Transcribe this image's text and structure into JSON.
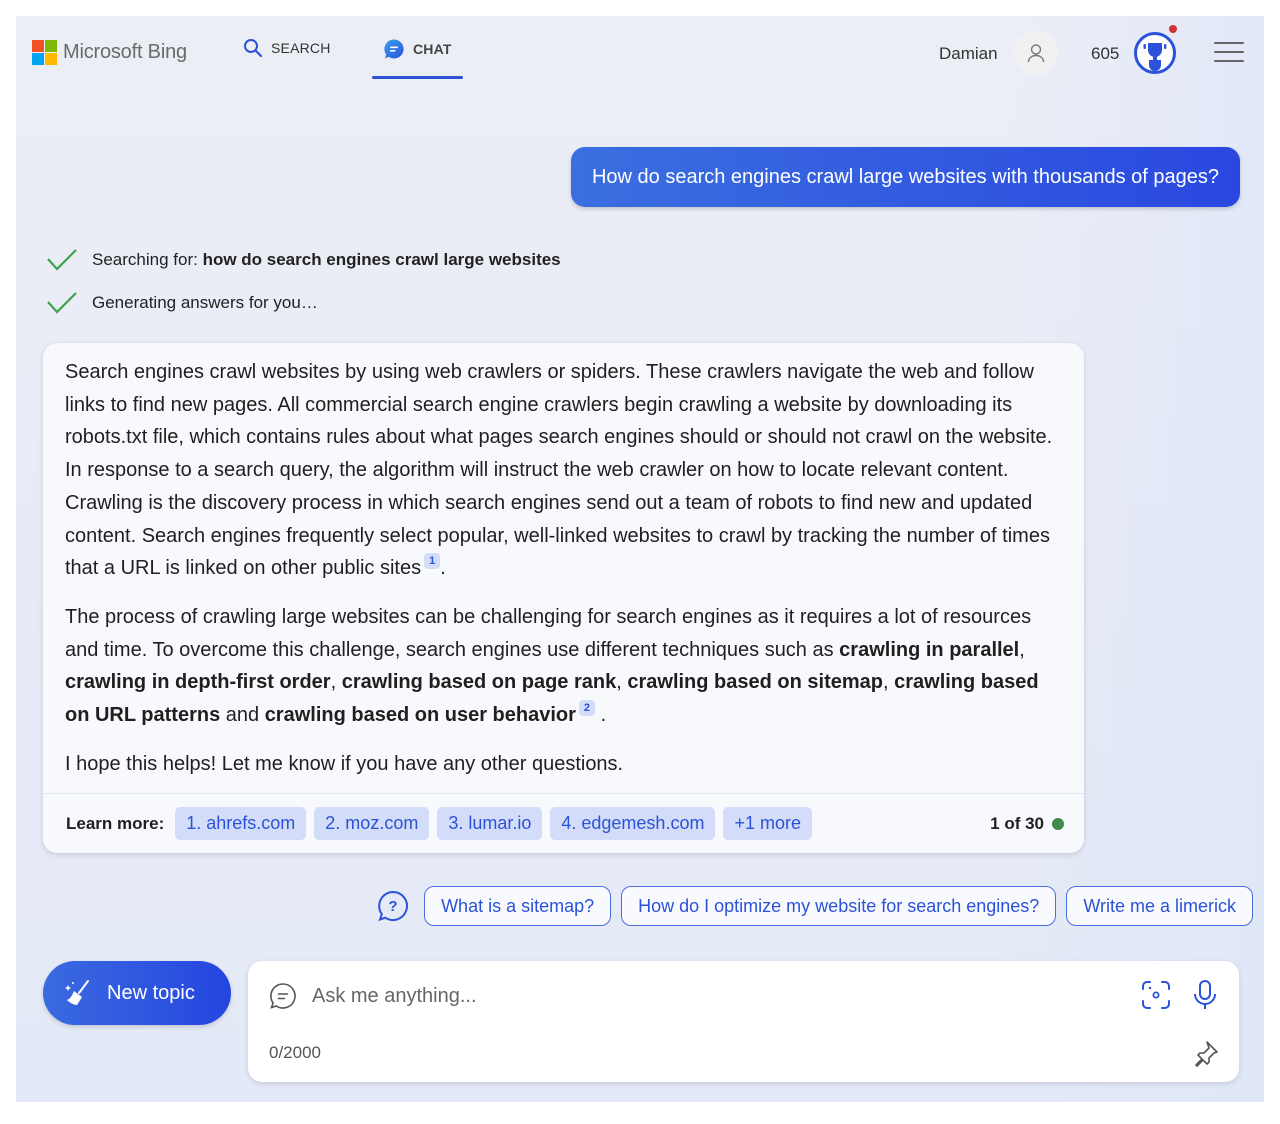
{
  "header": {
    "brand": "Microsoft Bing",
    "logo_colors": [
      "#f25022",
      "#7fba00",
      "#00a4ef",
      "#ffb900"
    ],
    "tabs": [
      {
        "label": "SEARCH",
        "icon": "search-icon",
        "active": false
      },
      {
        "label": "CHAT",
        "icon": "chat-bubble-icon",
        "active": true
      }
    ],
    "user_name": "Damian",
    "rewards_points": "605",
    "accent_color": "#2b52d8"
  },
  "conversation": {
    "user_message": "How do search engines crawl large websites with thousands of pages?",
    "progress": [
      {
        "prefix": "Searching for: ",
        "query": "how do search engines crawl large websites",
        "status": "done"
      },
      {
        "prefix": "Generating answers for you…",
        "query": "",
        "status": "done"
      }
    ],
    "answer": {
      "paragraph1": "Search engines crawl websites by using web crawlers or spiders. These crawlers navigate the web and follow links to find new pages. All commercial search engine crawlers begin crawling a website by downloading its robots.txt file, which contains rules about what pages search engines should or should not crawl on the website. In response to a search query, the algorithm will instruct the web crawler on how to locate relevant content. Crawling is the discovery process in which search engines send out a team of robots to find new and updated content. Search engines frequently select popular, well-linked websites to crawl by tracking the number of times that a URL is linked on other public sites",
      "citation1": "1",
      "paragraph2_intro": "The process of crawling large websites can be challenging for search engines as it requires a lot of resources and time. To overcome this challenge, search engines use different techniques such as ",
      "techniques": [
        "crawling in parallel",
        "crawling in depth-first order",
        "crawling based on page rank",
        "crawling based on sitemap",
        "crawling based on URL patterns",
        "crawling based on user behavior"
      ],
      "sep_comma": ", ",
      "sep_and": " and ",
      "period": ".",
      "citation2": "2",
      "paragraph3": "I hope this helps! Let me know if you have any other questions."
    },
    "learn_more": {
      "label": "Learn more:",
      "sources": [
        "1. ahrefs.com",
        "2. moz.com",
        "3. lumar.io",
        "4. edgemesh.com",
        "+1 more"
      ],
      "turn_counter": "1 of 30",
      "turn_status_color": "#3f8b48"
    }
  },
  "suggestions": [
    "What is a sitemap?",
    "How do I optimize my website for search engines?",
    "Write me a limerick"
  ],
  "composer": {
    "new_topic_label": "New topic",
    "placeholder": "Ask me anything...",
    "value": "",
    "char_count": "0/2000"
  }
}
